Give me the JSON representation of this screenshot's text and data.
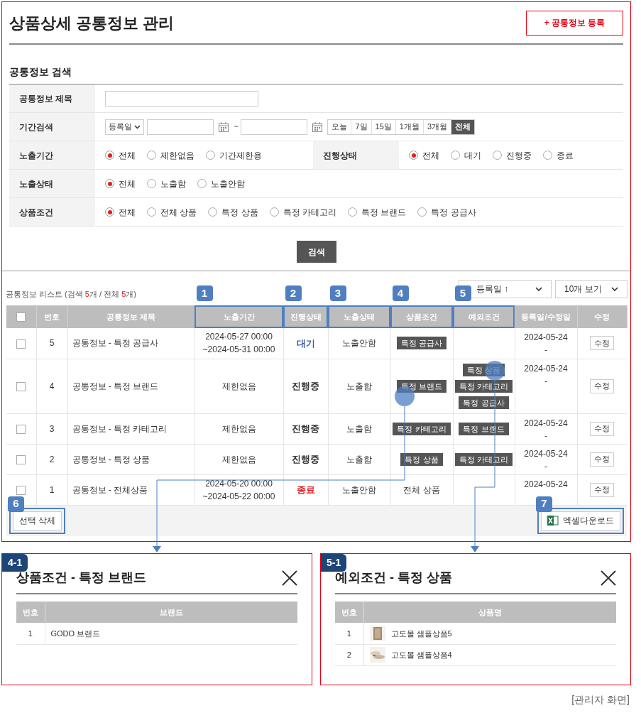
{
  "title": "상품상세 공통정보 관리",
  "register_button": "+ 공통정보 등록",
  "search": {
    "title": "공통정보 검색",
    "title_field": {
      "label": "공통정보 제목"
    },
    "period": {
      "label": "기간검색",
      "date_type": "등록일",
      "separator": "~",
      "ranges": [
        {
          "label": "오늘",
          "selected": false
        },
        {
          "label": "7일",
          "selected": false
        },
        {
          "label": "15일",
          "selected": false
        },
        {
          "label": "1개월",
          "selected": false
        },
        {
          "label": "3개월",
          "selected": false
        },
        {
          "label": "전체",
          "selected": true
        }
      ]
    },
    "radio_rows": [
      {
        "groups": [
          {
            "label": "노출기간",
            "options": [
              {
                "label": "전체",
                "selected": true
              },
              {
                "label": "제한없음",
                "selected": false
              },
              {
                "label": "기간제한용",
                "selected": false
              }
            ]
          },
          {
            "label": "진행상태",
            "options": [
              {
                "label": "전체",
                "selected": true
              },
              {
                "label": "대기",
                "selected": false
              },
              {
                "label": "진행중",
                "selected": false
              },
              {
                "label": "종료",
                "selected": false
              }
            ]
          }
        ]
      },
      {
        "groups": [
          {
            "label": "노출상태",
            "options": [
              {
                "label": "전체",
                "selected": true
              },
              {
                "label": "노출함",
                "selected": false
              },
              {
                "label": "노출안함",
                "selected": false
              }
            ]
          }
        ]
      },
      {
        "groups": [
          {
            "label": "상품조건",
            "options": [
              {
                "label": "전체",
                "selected": true
              },
              {
                "label": "전체 상품",
                "selected": false
              },
              {
                "label": "특정 상품",
                "selected": false
              },
              {
                "label": "특정 카테고리",
                "selected": false
              },
              {
                "label": "특정 브랜드",
                "selected": false
              },
              {
                "label": "특정 공급사",
                "selected": false
              }
            ]
          }
        ]
      }
    ],
    "search_button": "검색"
  },
  "list": {
    "summary": {
      "prefix": "공통정보 리스트 (검색 ",
      "search_count": "5",
      "middle": "개 / 전체 ",
      "total_count": "5",
      "suffix": "개)"
    },
    "sort_select": "등록일 ↑",
    "page_size_select": "10개 보기",
    "columns": [
      {
        "kind": "checkbox",
        "checked": false
      },
      {
        "label": "번호"
      },
      {
        "label": "공통정보 제목"
      },
      {
        "label": "노출기간",
        "callout": "1"
      },
      {
        "label": "진행상태",
        "callout": "2"
      },
      {
        "label": "노출상태",
        "callout": "3"
      },
      {
        "label": "상품조건",
        "callout": "4"
      },
      {
        "label": "예외조건",
        "callout": "5"
      },
      {
        "label": "등록일/수정일"
      },
      {
        "label": "수정"
      }
    ],
    "rows": [
      {
        "checked": false,
        "no": "5",
        "title": "공통정보 - 특정 공급사",
        "period": [
          "2024-05-27 00:00",
          "~2024-05-31 00:00"
        ],
        "status": {
          "text": "대기",
          "color": "#3b5ca8"
        },
        "exposure": "노출안함",
        "condition": {
          "kind": "tag",
          "text": "특정 공급사"
        },
        "exceptions": [],
        "dates": [
          "2024-05-24",
          "-"
        ],
        "edit": "수정"
      },
      {
        "checked": false,
        "no": "4",
        "title": "공통정보 - 특정 브랜드",
        "period": [
          "제한없음"
        ],
        "status": {
          "text": "진행중",
          "color": "#333333"
        },
        "exposure": "노출함",
        "condition": {
          "kind": "tag",
          "text": "특정 브랜드"
        },
        "exceptions": [
          "특정 상품",
          "특정 카테고리",
          "특정 공급사"
        ],
        "dates": [
          "2024-05-24",
          "-"
        ],
        "edit": "수정"
      },
      {
        "checked": false,
        "no": "3",
        "title": "공통정보 - 특정 카테고리",
        "period": [
          "제한없음"
        ],
        "status": {
          "text": "진행중",
          "color": "#333333"
        },
        "exposure": "노출함",
        "condition": {
          "kind": "tag",
          "text": "특정 카테고리"
        },
        "exceptions": [
          "특정 브랜드"
        ],
        "dates": [
          "2024-05-24",
          "-"
        ],
        "edit": "수정"
      },
      {
        "checked": false,
        "no": "2",
        "title": "공통정보 - 특정 상품",
        "period": [
          "제한없음"
        ],
        "status": {
          "text": "진행중",
          "color": "#333333"
        },
        "exposure": "노출함",
        "condition": {
          "kind": "tag",
          "text": "특정 상품"
        },
        "exceptions": [
          "특정 카테고리"
        ],
        "dates": [
          "2024-05-24",
          "-"
        ],
        "edit": "수정"
      },
      {
        "checked": false,
        "no": "1",
        "title": "공통정보 - 전체상품",
        "period": [
          "2024-05-20 00:00",
          "~2024-05-22 00:00"
        ],
        "status": {
          "text": "종료",
          "color": "#e02020"
        },
        "exposure": "노출안함",
        "condition": {
          "kind": "text",
          "text": "전체 상품"
        },
        "exceptions": [],
        "dates": [
          "2024-05-24"
        ],
        "edit": "수정"
      }
    ],
    "delete_button": {
      "label": "선택 삭제",
      "callout": "6"
    },
    "excel_button": {
      "label": "엑셀다운로드",
      "callout": "7"
    }
  },
  "popups": [
    {
      "badge": "4-1",
      "title": "상품조건 - 특정 브랜드",
      "columns": [
        "번호",
        "브랜드"
      ],
      "rows": [
        {
          "no": "1",
          "name": "GODO 브랜드"
        }
      ]
    },
    {
      "badge": "5-1",
      "title": "예외조건 - 특정 상품",
      "columns": [
        "번호",
        "상품명"
      ],
      "rows": [
        {
          "no": "1",
          "name": "고도몰 샘플상품5",
          "kind": "picture"
        },
        {
          "no": "2",
          "name": "고도몰 샘플상품4",
          "kind": "picture"
        }
      ]
    }
  ],
  "caption": "[관리자 화면]"
}
